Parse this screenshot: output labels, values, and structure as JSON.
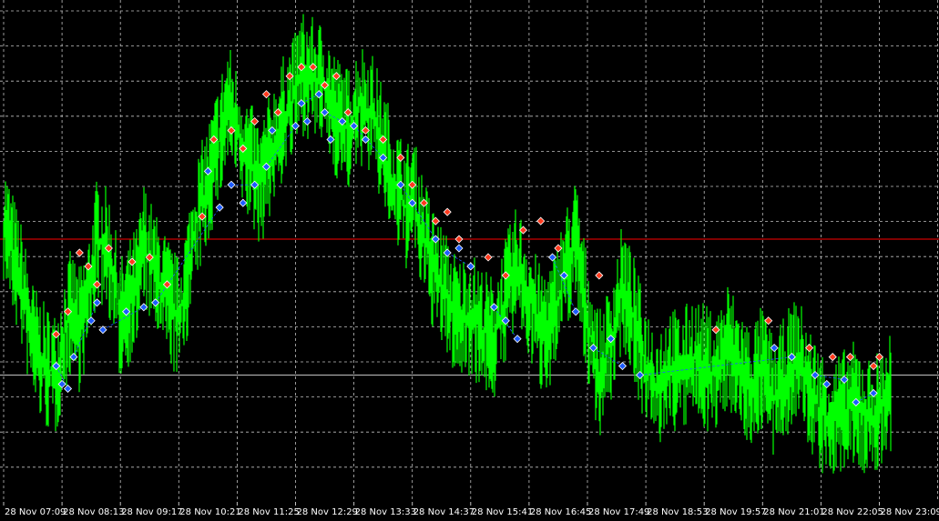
{
  "chart_data": {
    "type": "line",
    "x_ticks": [
      "28 Nov 07:09",
      "28 Nov 08:13",
      "28 Nov 09:17",
      "28 Nov 10:21",
      "28 Nov 11:25",
      "28 Nov 12:29",
      "28 Nov 13:33",
      "28 Nov 14:37",
      "28 Nov 15:41",
      "28 Nov 16:45",
      "28 Nov 17:49",
      "28 Nov 18:53",
      "28 Nov 19:57",
      "28 Nov 21:01",
      "28 Nov 22:05",
      "28 Nov 23:09"
    ],
    "price_series": {
      "t": [
        0,
        0.3,
        0.5,
        0.7,
        0.9,
        1.0,
        1.15,
        1.3,
        1.45,
        1.6,
        1.8,
        2.0,
        2.15,
        2.3,
        2.4,
        2.6,
        2.8,
        3.0,
        3.15,
        3.3,
        3.5,
        3.7,
        3.85,
        4.0,
        4.2,
        4.4,
        4.6,
        4.8,
        5.0,
        5.1,
        5.3,
        5.5,
        5.7,
        5.9,
        6.1,
        6.3,
        6.5,
        6.7,
        6.9,
        7.0,
        7.2,
        7.4,
        7.6,
        7.8,
        8.0,
        8.2,
        8.4,
        8.6,
        8.8,
        9.0,
        9.2,
        9.4,
        9.6,
        9.8,
        10.0,
        10.2,
        10.4,
        10.6,
        10.8,
        11.0,
        11.2,
        11.4,
        11.6,
        11.8,
        12.0,
        12.2,
        12.4,
        12.6,
        12.8,
        13.0,
        13.2,
        13.4,
        13.6,
        13.8,
        14.0,
        14.2,
        14.4,
        14.6,
        14.8,
        15.0,
        15.2
      ],
      "v": [
        52,
        38,
        25,
        20,
        18,
        25,
        32,
        28,
        35,
        48,
        45,
        30,
        34,
        38,
        47,
        40,
        35,
        30,
        40,
        52,
        60,
        70,
        78,
        72,
        65,
        60,
        68,
        75,
        80,
        85,
        83,
        82,
        75,
        72,
        78,
        76,
        68,
        60,
        55,
        58,
        48,
        40,
        35,
        30,
        32,
        28,
        26,
        35,
        42,
        35,
        28,
        30,
        40,
        48,
        30,
        18,
        25,
        38,
        30,
        20,
        15,
        20,
        18,
        22,
        20,
        18,
        25,
        20,
        15,
        20,
        12,
        18,
        22,
        15,
        10,
        8,
        10,
        12,
        8,
        10,
        15
      ],
      "range": [
        -10,
        100
      ]
    },
    "signals": {
      "buy_t": [
        0.9,
        1.0,
        1.1,
        1.2,
        1.5,
        1.6,
        1.7,
        2.1,
        2.4,
        2.6,
        3.5,
        3.7,
        3.9,
        4.1,
        4.3,
        4.5,
        4.6,
        5.0,
        5.1,
        5.2,
        5.4,
        5.5,
        5.6,
        5.8,
        6.0,
        6.2,
        6.5,
        6.8,
        7.0,
        7.4,
        7.6,
        7.8,
        8.0,
        8.4,
        8.6,
        8.8,
        9.4,
        9.6,
        9.8,
        10.1,
        10.4,
        10.6,
        10.9,
        13.2,
        13.5,
        13.9,
        14.1,
        14.4,
        14.6,
        14.9
      ],
      "buy_v": [
        20,
        16,
        15,
        22,
        30,
        34,
        28,
        32,
        33,
        34,
        63,
        55,
        60,
        56,
        60,
        64,
        72,
        73,
        78,
        74,
        80,
        76,
        70,
        74,
        73,
        70,
        66,
        60,
        56,
        48,
        45,
        46,
        42,
        33,
        30,
        26,
        44,
        40,
        32,
        24,
        26,
        20,
        18,
        24,
        22,
        18,
        16,
        17,
        12,
        14
      ],
      "sell_t": [
        0.9,
        1.1,
        1.3,
        1.45,
        1.6,
        1.8,
        2.2,
        2.5,
        2.8,
        3.4,
        3.6,
        3.9,
        4.1,
        4.3,
        4.5,
        4.7,
        4.9,
        5.1,
        5.3,
        5.5,
        5.7,
        5.9,
        6.2,
        6.5,
        6.8,
        7.0,
        7.2,
        7.4,
        7.6,
        7.8,
        8.3,
        8.6,
        8.9,
        9.2,
        9.5,
        10.2,
        12.2,
        13.1,
        13.8,
        14.2,
        14.5,
        14.9,
        15.0
      ],
      "sell_v": [
        27,
        32,
        45,
        42,
        38,
        46,
        43,
        44,
        38,
        53,
        70,
        72,
        68,
        74,
        80,
        76,
        84,
        86,
        86,
        82,
        84,
        76,
        72,
        70,
        66,
        60,
        56,
        52,
        54,
        48,
        44,
        40,
        50,
        52,
        46,
        40,
        28,
        30,
        24,
        22,
        22,
        20,
        22
      ],
      "range": [
        -10,
        100
      ]
    },
    "reference_lines": [
      {
        "color": "#ff0000",
        "level": 48
      },
      {
        "color": "#c0c0c0",
        "level": 18
      }
    ],
    "grid": true,
    "colors": {
      "background": "#000000",
      "grid": "#c0c0c0",
      "price": "#00ff00",
      "buy": "#1e5cff",
      "sell": "#ff3a1e",
      "tick_text": "#ffffff"
    }
  }
}
